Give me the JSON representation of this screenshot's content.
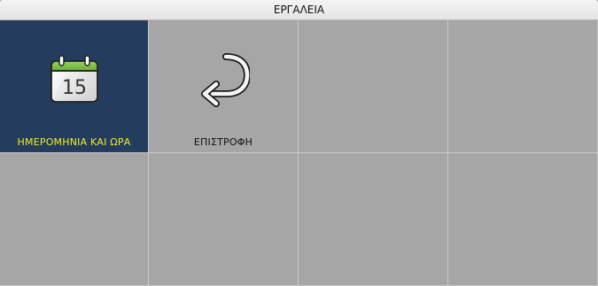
{
  "window": {
    "title": "ΕΡΓΑΛΕΙΑ"
  },
  "grid": {
    "tiles": [
      {
        "label": "ΗΜΕΡΟΜΗΝΙΑ ΚΑΙ ΩΡΑ",
        "icon": "calendar-icon",
        "day": "15",
        "selected": true
      },
      {
        "label": "ΕΠΙΣΤΡΟΦΗ",
        "icon": "return-arrow-icon",
        "selected": false
      },
      {
        "label": "",
        "selected": false
      },
      {
        "label": "",
        "selected": false
      },
      {
        "label": "",
        "selected": false
      },
      {
        "label": "",
        "selected": false
      },
      {
        "label": "",
        "selected": false
      },
      {
        "label": "",
        "selected": false
      }
    ]
  },
  "colors": {
    "selected_background": "#243c5e",
    "selected_label": "#f2ee1f",
    "tile_background": "#a6a6a6",
    "calendar_header": "#7dc24a"
  }
}
